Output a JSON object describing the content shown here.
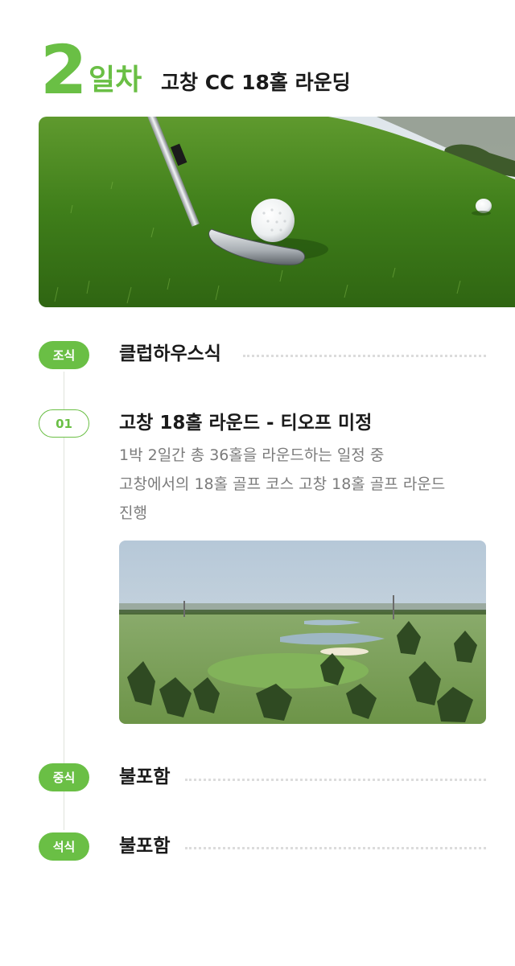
{
  "day": {
    "number": "2",
    "unit": "일차",
    "title": "고창 CC 18홀 라운딩"
  },
  "hero_image": {
    "subject": "golf-club-and-ball-on-grass"
  },
  "schedule": {
    "breakfast": {
      "badge": "조식",
      "label": "클럽하우스식"
    },
    "round": {
      "badge": "01",
      "title": "고창 18홀 라운드 - 티오프 미정",
      "description_lines": [
        "1박 2일간 총 36홀을 라운드하는 일정 중",
        "고창에서의 18홀 골프 코스 고창 18홀 골프 라운드",
        "진행"
      ]
    },
    "course_image": {
      "subject": "golf-course-landscape"
    },
    "lunch": {
      "badge": "중식",
      "label": "불포함"
    },
    "dinner": {
      "badge": "석식",
      "label": "불포함"
    }
  },
  "colors": {
    "accent": "#6abf45",
    "text_primary": "#1a1a1a",
    "text_secondary": "#7b7b7b",
    "dotted_leader": "#dcdcdc",
    "timeline": "#dfe3db"
  }
}
